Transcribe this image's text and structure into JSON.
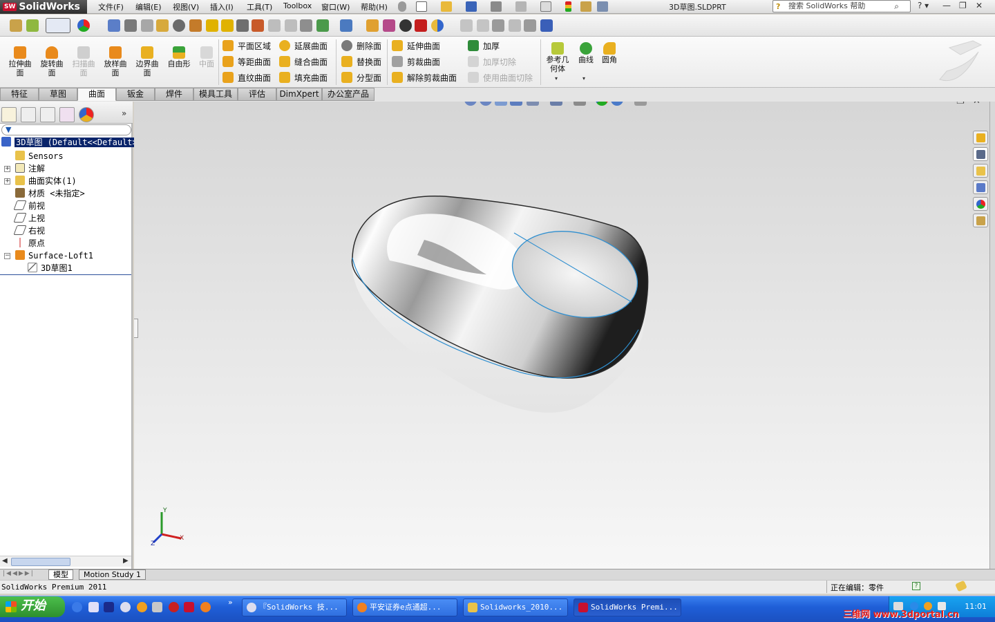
{
  "app": {
    "brand": "SolidWorks",
    "doc_title": "3D草图.SLDPRT",
    "brand_color": "#c8102e"
  },
  "menu": [
    "文件(F)",
    "编辑(E)",
    "视图(V)",
    "插入(I)",
    "工具(T)",
    "Toolbox",
    "窗口(W)",
    "帮助(H)"
  ],
  "help_search": {
    "placeholder": "搜索 SolidWorks 帮助"
  },
  "commands": {
    "big": [
      {
        "label": "拉伸曲面",
        "icon": "extruded-surface-icon"
      },
      {
        "label": "旋转曲面",
        "icon": "revolved-surface-icon"
      },
      {
        "label": "扫描曲面",
        "icon": "swept-surface-icon",
        "disabled": true
      },
      {
        "label": "放样曲面",
        "icon": "lofted-surface-icon"
      },
      {
        "label": "边界曲面",
        "icon": "boundary-surface-icon"
      },
      {
        "label": "自由形",
        "icon": "freeform-icon"
      },
      {
        "label": "中面",
        "icon": "mid-surface-icon",
        "disabled": true
      }
    ],
    "col1": [
      "平面区域",
      "等距曲面",
      "直纹曲面"
    ],
    "col2": [
      "延展曲面",
      "缝合曲面",
      "填充曲面"
    ],
    "col3": [
      "删除面",
      "替换面",
      "分型面"
    ],
    "col4": [
      "延伸曲面",
      "剪裁曲面",
      "解除剪裁曲面"
    ],
    "col5": [
      "加厚",
      "加厚切除",
      "使用曲面切除"
    ],
    "right": [
      "参考几何体",
      "曲线",
      "圆角"
    ]
  },
  "tabs": [
    "特征",
    "草图",
    "曲面",
    "钣金",
    "焊件",
    "模具工具",
    "评估",
    "DimXpert",
    "办公室产品"
  ],
  "active_tab": "曲面",
  "tree": {
    "root": "3D草图  (Default<<Default>_P",
    "items": [
      "Sensors",
      "注解",
      "曲面实体(1)",
      "材质 <未指定>",
      "前视",
      "上视",
      "右视",
      "原点",
      "Surface-Loft1",
      "3D草图1"
    ]
  },
  "triad": {
    "x": "X",
    "y": "Y",
    "z": "Z"
  },
  "bottom_tabs": [
    "模型",
    "Motion Study 1"
  ],
  "status": {
    "left": "SolidWorks Premium 2011",
    "right": "正在编辑：零件"
  },
  "taskbar": {
    "start": "开始",
    "buttons": [
      "『SolidWorks 技...",
      "平安证券e点通超...",
      "Solidworks_2010...",
      "SolidWorks Premi..."
    ],
    "clock": "11:01",
    "watermark": "三维网 www.3dportal.cn"
  }
}
